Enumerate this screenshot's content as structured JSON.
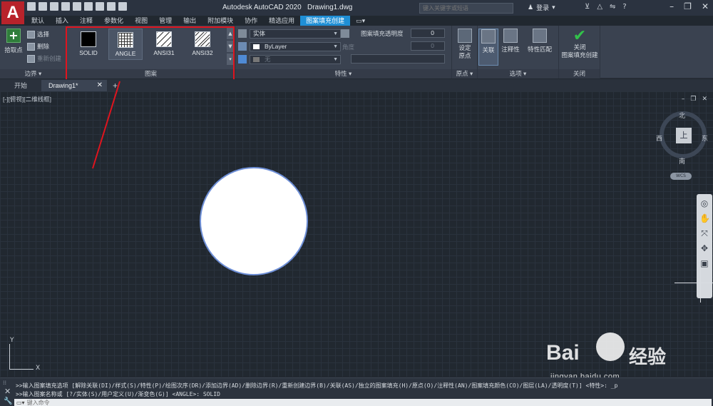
{
  "window": {
    "app_title": "Autodesk AutoCAD 2020",
    "file_name": "Drawing1.dwg",
    "logo_letter": "A"
  },
  "titlebar": {
    "search_placeholder": "键入关键字或短语",
    "login_label": "登录"
  },
  "ribbon_tabs": [
    "默认",
    "插入",
    "注释",
    "参数化",
    "视图",
    "管理",
    "输出",
    "附加模块",
    "协作",
    "精选应用",
    "图案填充创建"
  ],
  "ribbon_active_tab": "图案填充创建",
  "boundary_panel": {
    "pick_point_label": "拾取点",
    "select_label": "选择",
    "remove_label": "删除",
    "recreate_label": "重新创建",
    "footer": "边界"
  },
  "pattern_panel": {
    "swatches": [
      {
        "label": "SOLID"
      },
      {
        "label": "ANGLE"
      },
      {
        "label": "ANSI31"
      },
      {
        "label": "ANSI32"
      }
    ],
    "selected": "ANGLE",
    "footer": "图案"
  },
  "properties_panel": {
    "type_value": "实体",
    "color_value": "ByLayer",
    "background_value": "无",
    "transparency_label": "图案填充透明度",
    "transparency_value": "0",
    "angle_label": "角度",
    "angle_value": "0",
    "footer": "特性"
  },
  "origin_panel": {
    "set_origin_label_1": "设定",
    "set_origin_label_2": "原点",
    "footer": "原点"
  },
  "options_panel": {
    "associative_label": "关联",
    "annotative_label": "注释性",
    "match_properties_label": "特性匹配",
    "footer": "选项"
  },
  "close_panel": {
    "close_label_1": "关闭",
    "close_label_2": "图案填充创建",
    "footer": "关闭"
  },
  "doc_tabs": {
    "start_tab": "开始",
    "drawing_tab": "Drawing1*"
  },
  "viewport": {
    "label": "[-][俯视][二维线框]"
  },
  "viewcube": {
    "north": "北",
    "south": "南",
    "west": "西",
    "east": "东",
    "top_face": "上",
    "wcs": "WCS"
  },
  "ucs": {
    "x_label": "X",
    "y_label": "Y"
  },
  "watermark": {
    "brand_text": "Bai",
    "brand_cn": "经验",
    "url": "jingyan.baidu.com"
  },
  "command": {
    "line1": ">>输入图案填充选项 [解除关联(DI)/样式(S)/特性(P)/绘图次序(DR)/添加边界(AD)/删除边界(R)/重新创建边界(B)/关联(AS)/独立的图案填充(H)/原点(O)/注释性(AN)/图案填充颜色(CO)/图层(LA)/透明度(T)] <特性>: _p",
    "line2": ">>输入图案名称或 [?/实体(S)/用户定义(U)/渐变色(G)] <ANGLE>: SOLID",
    "input_placeholder": "键入命令"
  },
  "colors": {
    "accent": "#1f8fd6",
    "highlight_red": "#e0141e",
    "circle_stroke": "#6e8fd7"
  }
}
